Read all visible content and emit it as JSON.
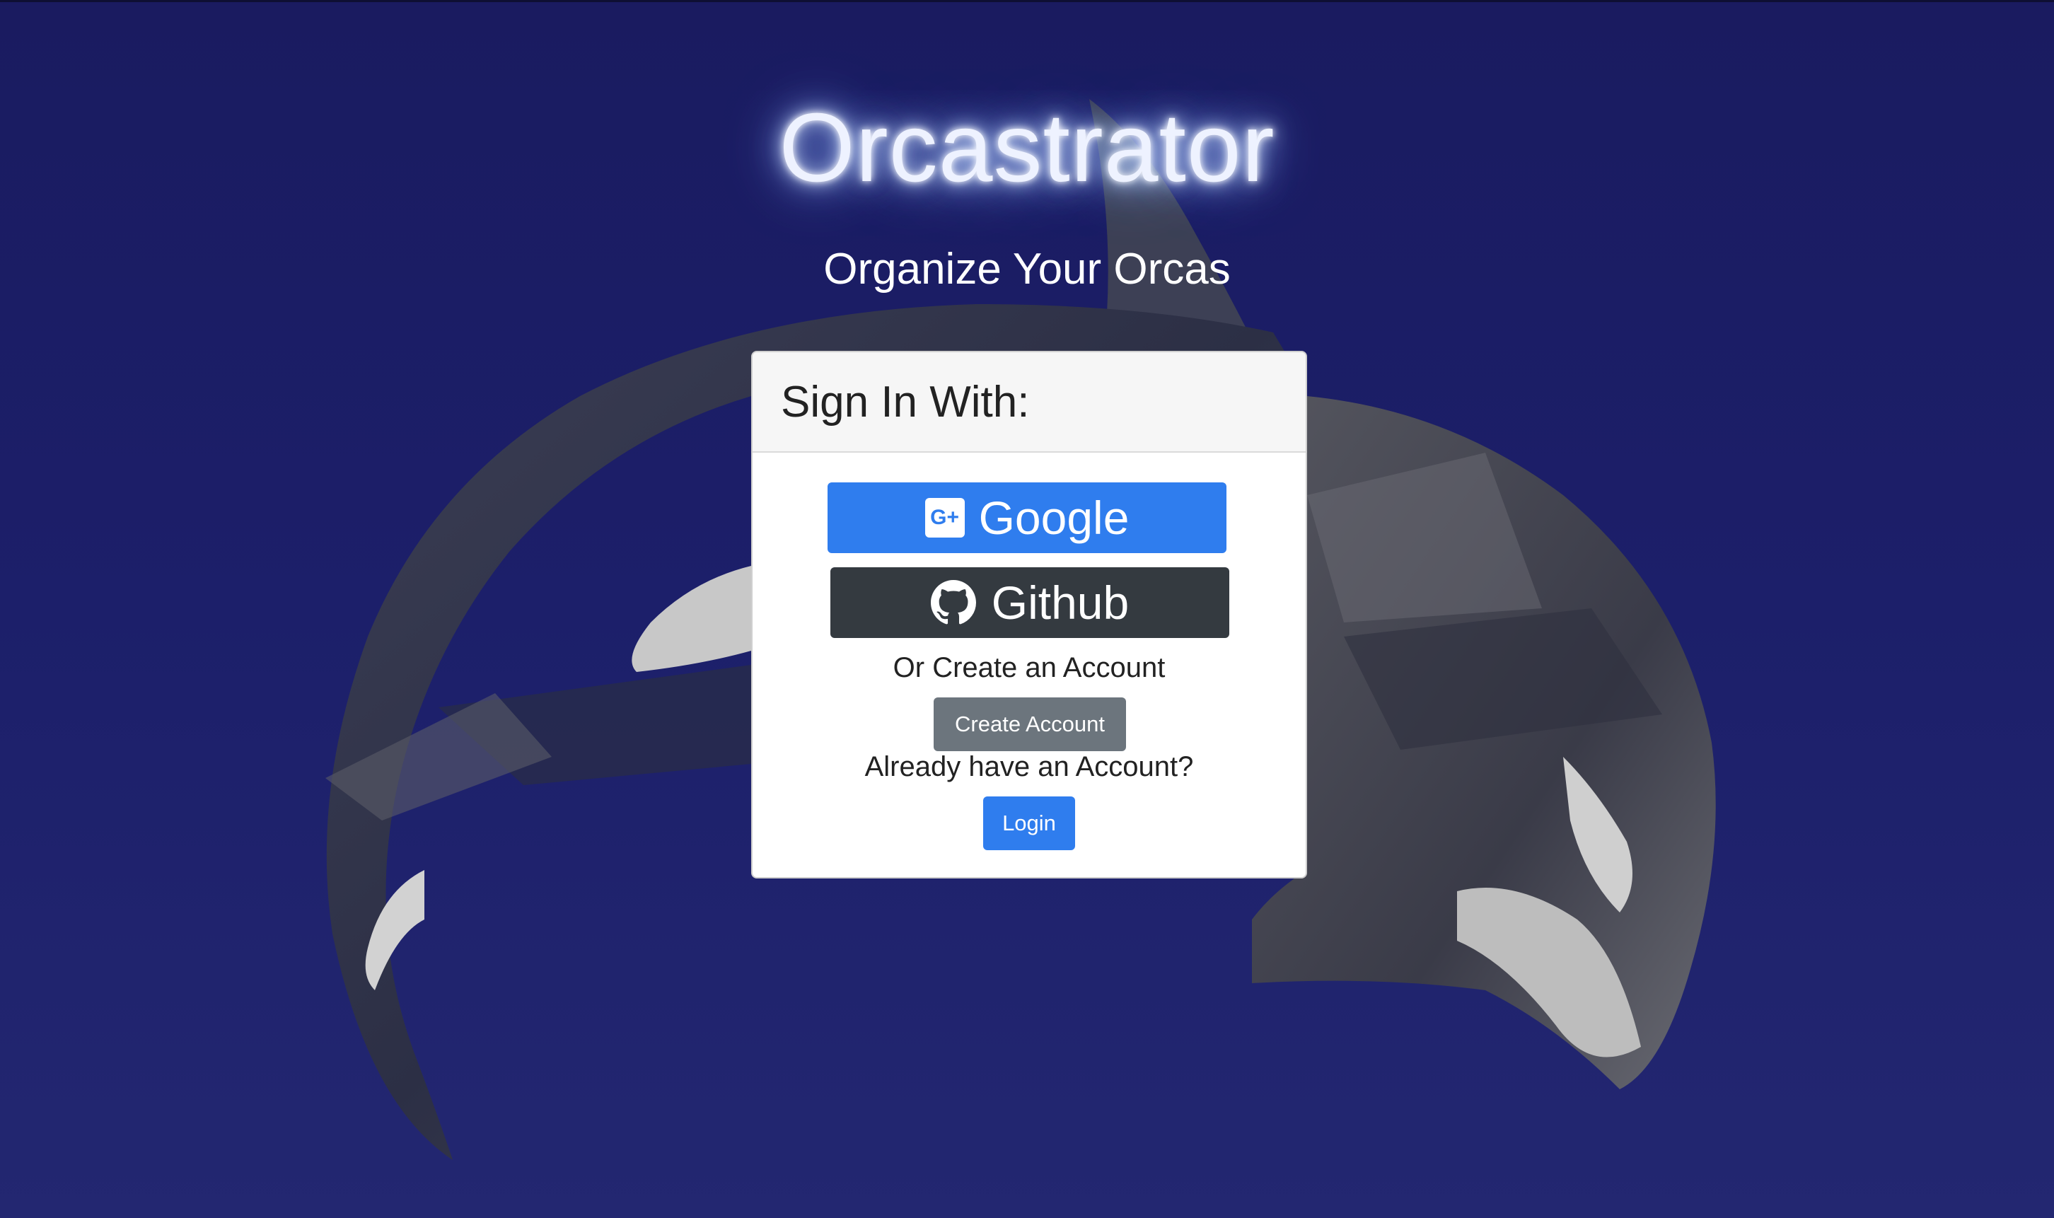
{
  "app": {
    "title": "Orcastrator",
    "subtitle": "Organize Your Orcas"
  },
  "signin": {
    "header": "Sign In With:",
    "google_label": "Google",
    "github_label": "Github",
    "create_prompt": "Or Create an Account",
    "create_button": "Create Account",
    "login_prompt": "Already have an Account?",
    "login_button": "Login"
  },
  "icons": {
    "google": "google-plus-icon",
    "github": "github-icon"
  },
  "colors": {
    "background": "#1c1f6a",
    "primary": "#2f7dee",
    "dark": "#343a40",
    "secondary": "#6c757d"
  }
}
